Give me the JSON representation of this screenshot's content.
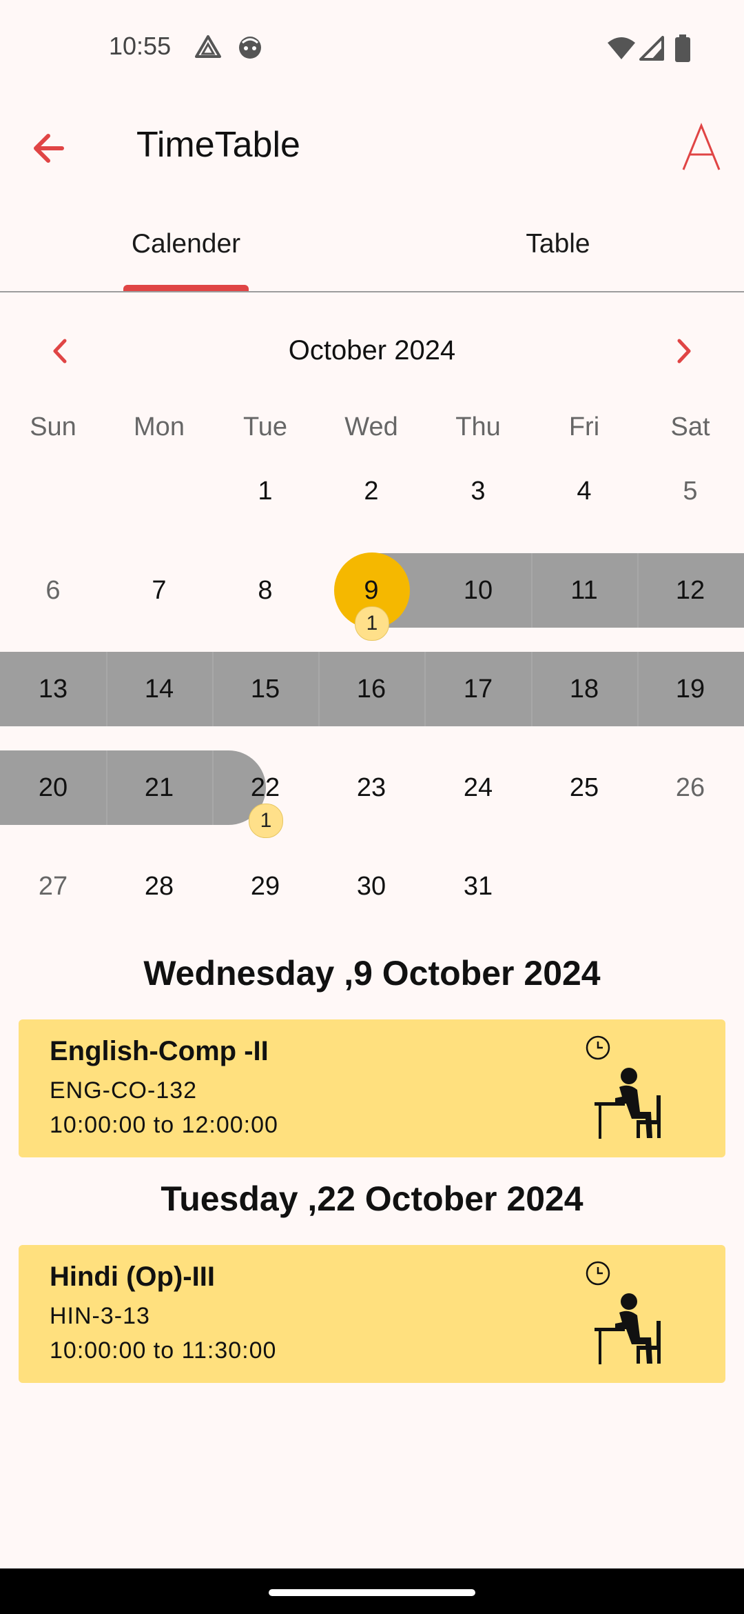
{
  "status_bar": {
    "time": "10:55"
  },
  "app_bar": {
    "title": "TimeTable"
  },
  "tabs": [
    {
      "label": "Calender",
      "selected": true
    },
    {
      "label": "Table",
      "selected": false
    }
  ],
  "calendar": {
    "month_label": "October 2024",
    "weekdays": [
      "Sun",
      "Mon",
      "Tue",
      "Wed",
      "Thu",
      "Fri",
      "Sat"
    ],
    "days": [
      "1",
      "2",
      "3",
      "4",
      "5",
      "6",
      "7",
      "8",
      "9",
      "10",
      "11",
      "12",
      "13",
      "14",
      "15",
      "16",
      "17",
      "18",
      "19",
      "20",
      "21",
      "22",
      "23",
      "24",
      "25",
      "26",
      "27",
      "28",
      "29",
      "30",
      "31"
    ],
    "selected_day": "9",
    "range_start_day": "9",
    "range_end_day": "22",
    "badges": [
      {
        "day": "9",
        "count": "1"
      },
      {
        "day": "22",
        "count": "1"
      }
    ],
    "colors": {
      "selected": "#F5B800",
      "range": "#9E9E9E",
      "badge": "#FFE08A"
    }
  },
  "schedule": [
    {
      "date_heading": "Wednesday ,9 October 2024",
      "title": "English-Comp -II",
      "code": "ENG-CO-132",
      "time": "10:00:00 to 12:00:00"
    },
    {
      "date_heading": "Tuesday ,22 October 2024",
      "title": "Hindi (Op)-III",
      "code": "HIN-3-13",
      "time": "10:00:00 to 11:30:00"
    }
  ],
  "colors": {
    "accent": "#E04545",
    "card": "#FFE07E",
    "background": "#FFF8F7"
  }
}
